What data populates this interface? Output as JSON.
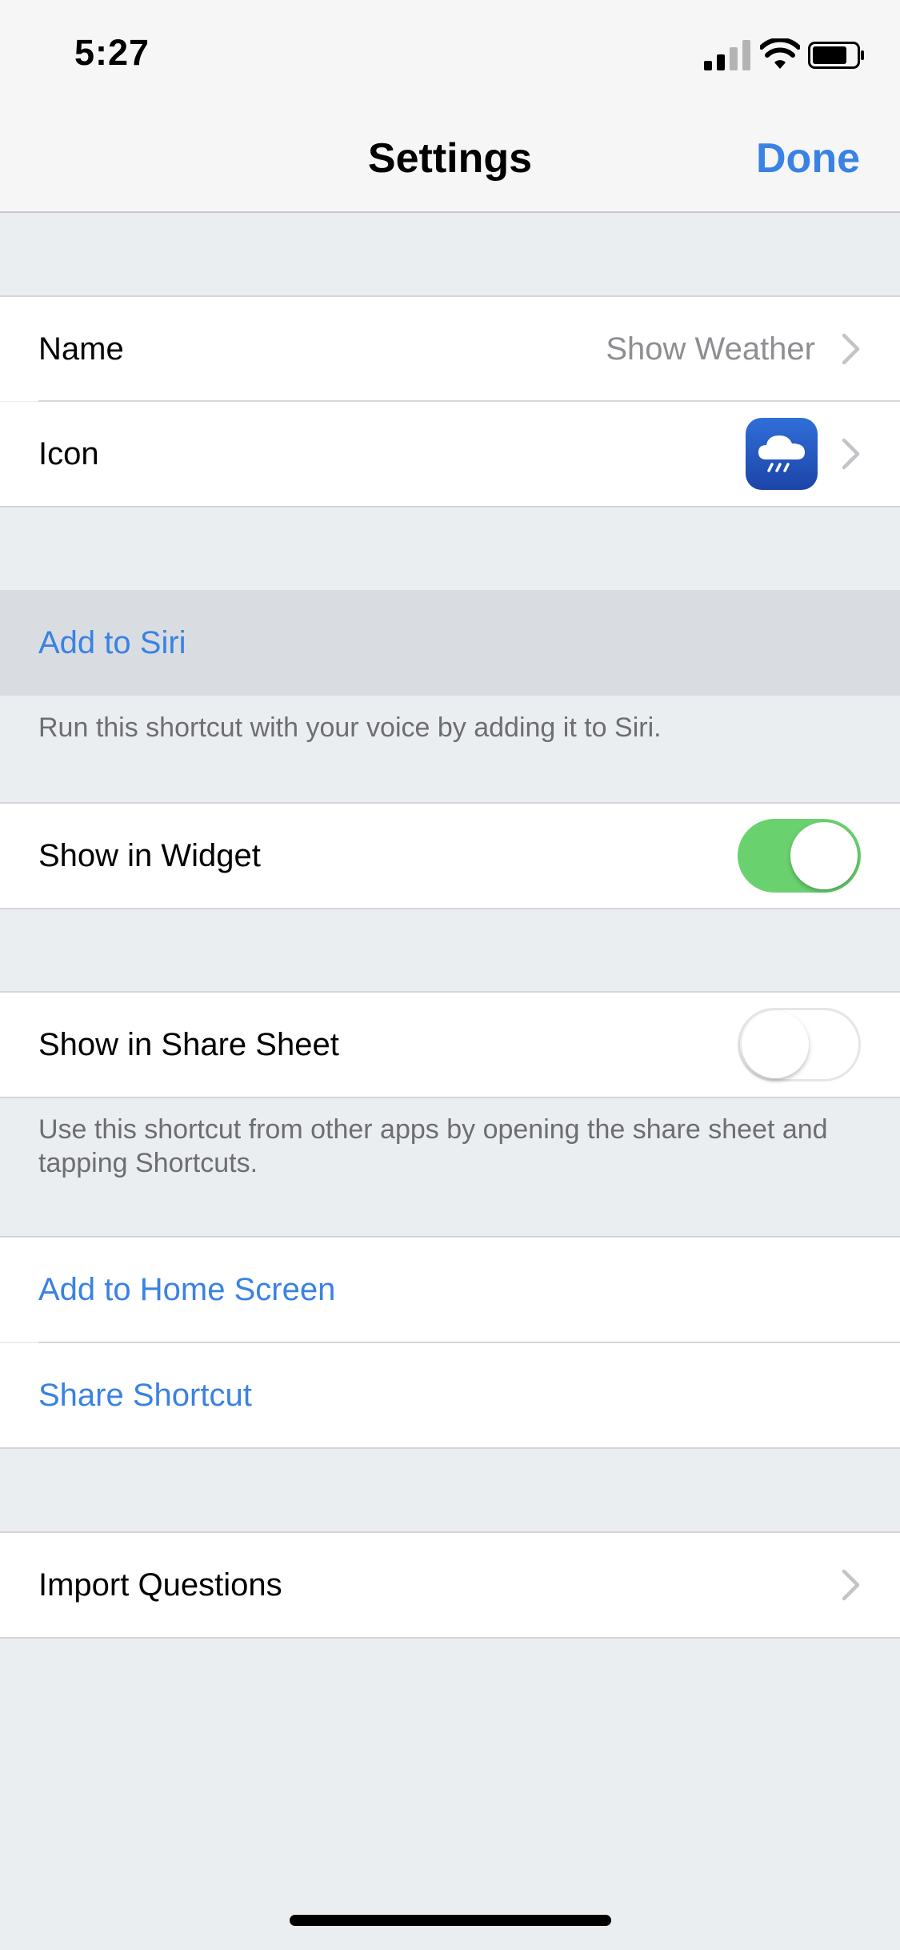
{
  "status_bar": {
    "time": "5:27",
    "icons": [
      "cellular-signal-icon",
      "wifi-icon",
      "battery-icon"
    ]
  },
  "nav": {
    "title": "Settings",
    "done_label": "Done"
  },
  "rows": {
    "name": {
      "label": "Name",
      "value": "Show Weather"
    },
    "icon": {
      "label": "Icon",
      "icon": "rain-cloud-icon"
    },
    "add_to_siri": {
      "label": "Add to Siri",
      "footer": "Run this shortcut with your voice by adding it to Siri."
    },
    "show_in_widget": {
      "label": "Show in Widget",
      "enabled": true
    },
    "show_in_share_sheet": {
      "label": "Show in Share Sheet",
      "enabled": false,
      "footer": "Use this shortcut from other apps by opening the share sheet and tapping Shortcuts."
    },
    "add_to_home_screen": {
      "label": "Add to Home Screen"
    },
    "share_shortcut": {
      "label": "Share Shortcut"
    },
    "import_questions": {
      "label": "Import Questions"
    }
  },
  "colors": {
    "accent": "#3a82e3",
    "toggle_on": "#6ad16f",
    "background": "#ebeef1",
    "icon_blue": "#2f6fd8"
  }
}
